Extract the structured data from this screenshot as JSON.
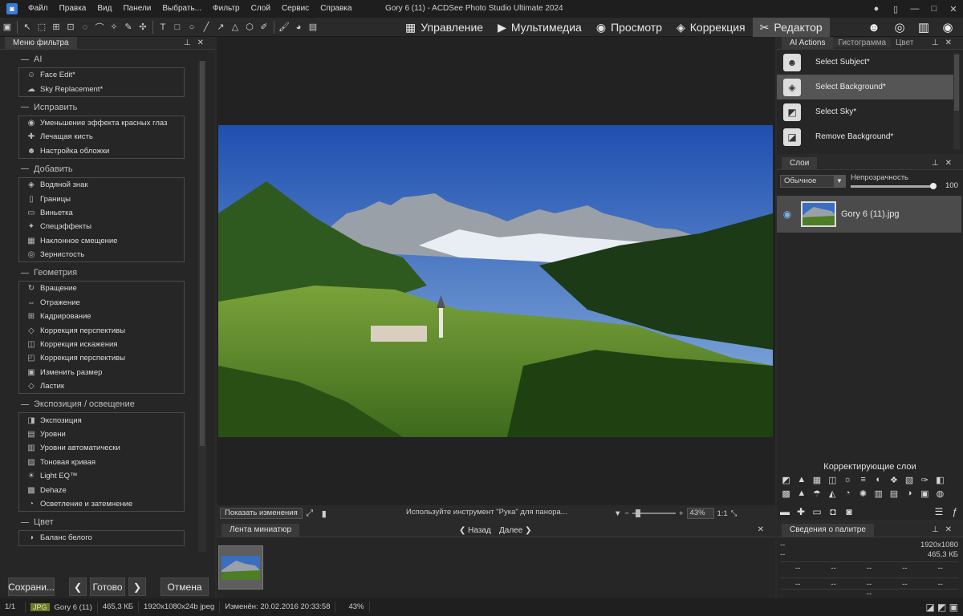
{
  "window": {
    "title": "Gory 6 (11) - ACDSee Photo Studio Ultimate 2024",
    "menu": [
      "Файл",
      "Правка",
      "Вид",
      "Панели",
      "Выбрать...",
      "Фильтр",
      "Слой",
      "Сервис",
      "Справка"
    ]
  },
  "modes": [
    {
      "label": "Управление",
      "icon": "grid-icon"
    },
    {
      "label": "Мультимедиа",
      "icon": "media-icon"
    },
    {
      "label": "Просмотр",
      "icon": "eye-icon"
    },
    {
      "label": "Коррекция",
      "icon": "develop-icon"
    },
    {
      "label": "Редактор",
      "icon": "edit-icon",
      "active": true
    }
  ],
  "filter_panel": {
    "tab": "Меню фильтра",
    "sections": [
      {
        "title": "AI",
        "items": [
          "Face Edit*",
          "Sky Replacement*"
        ]
      },
      {
        "title": "Исправить",
        "items": [
          "Уменьшение эффекта красных глаз",
          "Лечащая кисть",
          "Настройка обложки"
        ]
      },
      {
        "title": "Добавить",
        "items": [
          "Водяной знак",
          "Границы",
          "Виньетка",
          "Спецэффекты",
          "Наклонное смещение",
          "Зернистость"
        ]
      },
      {
        "title": "Геометрия",
        "items": [
          "Вращение",
          "Отражение",
          "Кадрирование",
          "Коррекция перспективы",
          "Коррекция искажения",
          "Коррекция перспективы",
          "Изменить размер",
          "Ластик"
        ]
      },
      {
        "title": "Экспозиция / освещение",
        "items": [
          "Экспозиция",
          "Уровни",
          "Уровни автоматически",
          "Тоновая кривая",
          "Light EQ™",
          "Dehaze",
          "Осветление и затемнение"
        ]
      },
      {
        "title": "Цвет",
        "items": [
          "Баланс белого"
        ]
      }
    ],
    "buttons": {
      "save": "Сохрани...",
      "done": "Готово",
      "cancel": "Отмена"
    }
  },
  "canvas": {
    "show_changes": "Показать изменения",
    "hint": "Используйте инструмент \"Рука\" для панора...",
    "zoom": "43%",
    "ratio": "1:1"
  },
  "filmstrip": {
    "tab": "Лента миниатюр",
    "back": "Назад",
    "next": "Далее"
  },
  "ai_actions": {
    "tabs": [
      "AI Actions",
      "Гистограмма",
      "Цвет"
    ],
    "items": [
      {
        "label": "Select Subject*",
        "selected": false
      },
      {
        "label": "Select Background*",
        "selected": true
      },
      {
        "label": "Select Sky*",
        "selected": false
      },
      {
        "label": "Remove Background*",
        "selected": false
      }
    ]
  },
  "layers": {
    "tab": "Слои",
    "blend_mode": "Обычное",
    "opacity_label": "Непрозрачность",
    "opacity_value": "100",
    "layer_name": "Gory 6 (11).jpg"
  },
  "adjustment_layers": {
    "title": "Корректирующие слои"
  },
  "palette_info": {
    "tab": "Сведения о палитре",
    "resolution": "1920x1080",
    "size": "465,3 КБ",
    "placeholder": "--"
  },
  "status": {
    "page": "1/1",
    "format": "JPG",
    "filename": "Gory 6 (11)",
    "filesize": "465,3 КБ",
    "dims": "1920x1080x24b jpeg",
    "modified": "Изменён: 20.02.2016 20:33:58",
    "zoom": "43%"
  }
}
